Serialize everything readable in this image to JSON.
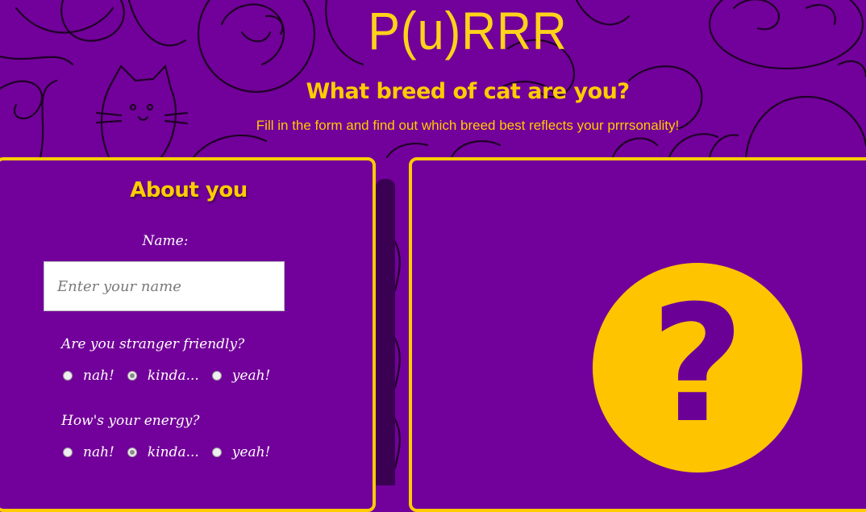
{
  "app": {
    "logo": "P(u)RRR",
    "subtitle": "What breed of cat are you?",
    "tagline": "Fill in the form and find out which breed best reflects your prrrsonality!"
  },
  "form": {
    "title": "About you",
    "name_label": "Name:",
    "name_placeholder": "Enter your name",
    "name_value": "",
    "questions": [
      {
        "label": "Are you stranger friendly?",
        "options": [
          "nah!",
          "kinda...",
          "yeah!"
        ],
        "selected": "kinda..."
      },
      {
        "label": "How's your energy?",
        "options": [
          "nah!",
          "kinda...",
          "yeah!"
        ],
        "selected": "kinda..."
      }
    ]
  },
  "result": {
    "icon": "question-mark-icon",
    "glyph": "?"
  },
  "colors": {
    "background": "#72009a",
    "accent": "#ffcc00",
    "doodle_stroke": "#1e0026",
    "result_glyph": "#6b0097"
  }
}
